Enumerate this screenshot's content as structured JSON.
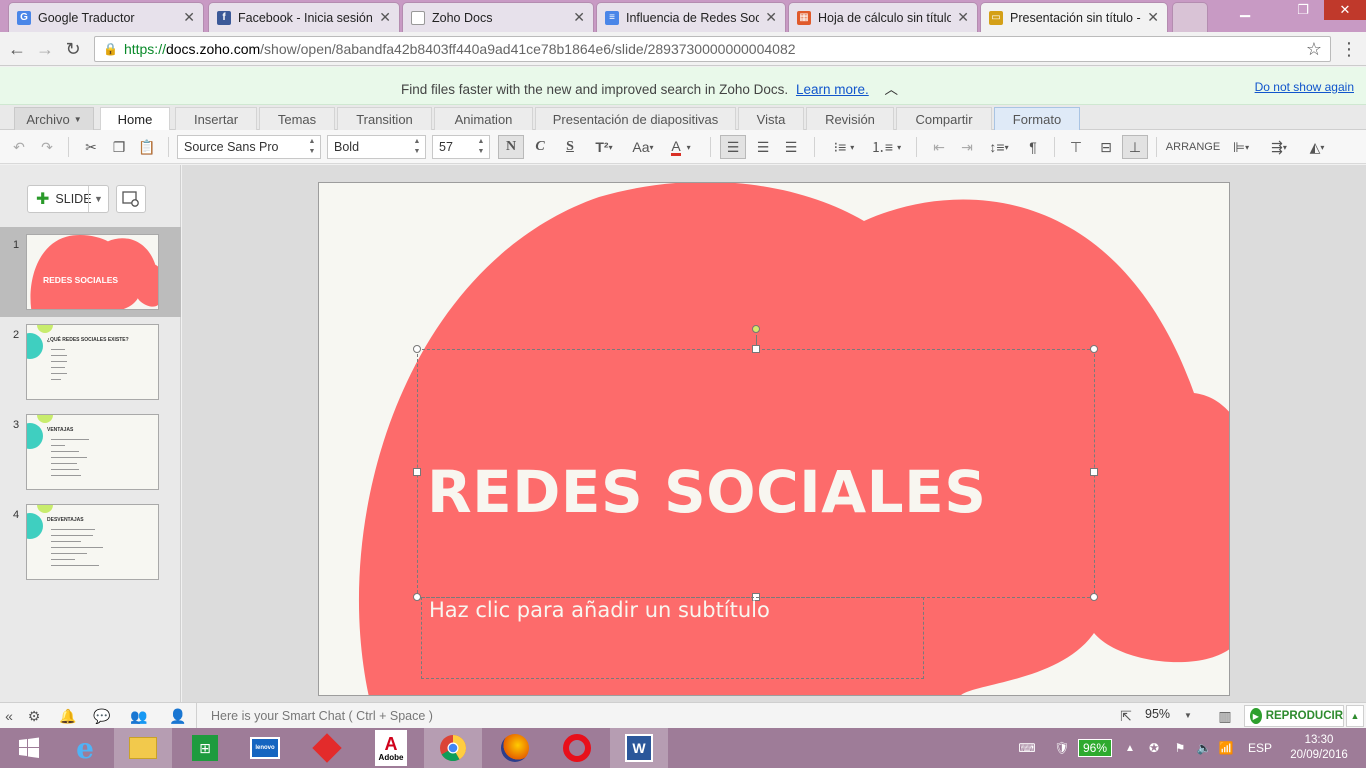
{
  "browser": {
    "tabs": [
      {
        "title": "Google Traductor",
        "favicon": "google-translate-icon",
        "color": "#4a86e8"
      },
      {
        "title": "Facebook - Inicia sesión o",
        "favicon": "facebook-icon",
        "color": "#3b5998"
      },
      {
        "title": "Zoho Docs",
        "favicon": "page-icon",
        "color": "#cccccc"
      },
      {
        "title": "Influencia de Redes Socia",
        "favicon": "writer-doc-icon",
        "color": "#4a86e8"
      },
      {
        "title": "Hoja de cálculo sin título",
        "favicon": "sheet-icon",
        "color": "#e05a2b"
      },
      {
        "title": "Presentación sin título - Z",
        "favicon": "show-icon",
        "color": "#d4a017"
      }
    ],
    "url": {
      "scheme": "https://",
      "domain": "docs.zoho.com",
      "path": "/show/open/8abandfa42b8403ff440a9ad41ce78b1864e6/slide/2893730000000004082"
    }
  },
  "notice": {
    "message": "Find files faster with the new and improved search in Zoho Docs.",
    "link": "Learn more.",
    "dismiss": "Do not show again"
  },
  "menu": {
    "archivo": "Archivo",
    "tabs": [
      "Home",
      "Insertar",
      "Temas",
      "Transition",
      "Animation",
      "Presentación de diapositivas",
      "Vista",
      "Revisión",
      "Compartir",
      "Formato"
    ]
  },
  "toolbar": {
    "font_family": "Source Sans Pro",
    "font_weight": "Bold",
    "font_size": "57",
    "bold_glyph": "N",
    "italic_glyph": "C",
    "underline_glyph": "S",
    "superscript_glyph": "T²",
    "case_glyph": "Aa",
    "color_glyph": "A",
    "arrange_label": "ARRANGE",
    "accent_color": "#d93025"
  },
  "left_panel": {
    "add_slide_label": "SLIDE",
    "slides": [
      {
        "number": "1",
        "title": "REDES SOCIALES"
      },
      {
        "number": "2",
        "title": "¿QUÉ REDES SOCIALES EXISTE?"
      },
      {
        "number": "3",
        "title": "VENTAJAS"
      },
      {
        "number": "4",
        "title": "DESVENTAJAS"
      }
    ]
  },
  "slide": {
    "title": "REDES SOCIALES",
    "subtitle_placeholder": "Haz clic para añadir un subtítulo",
    "shape_color": "#fd6b6b",
    "background": "#f7f7f2"
  },
  "status": {
    "chat_placeholder": "Here is your Smart Chat ( Ctrl + Space )",
    "zoom": "95%",
    "play_label": "REPRODUCIR"
  },
  "taskbar": {
    "battery": "96%",
    "lang": "ESP",
    "time": "13:30",
    "date": "20/09/2016",
    "adobe_label": "Adobe"
  }
}
